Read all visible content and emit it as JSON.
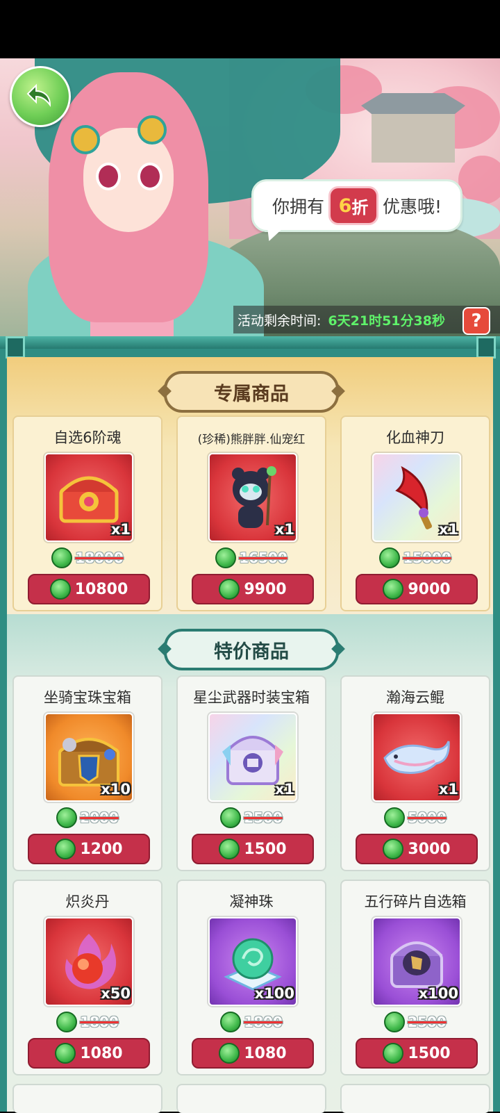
{
  "banner": {
    "bubble_prefix": "你拥有",
    "discount_number": "6",
    "discount_suffix": "折",
    "bubble_suffix": "优惠哦!",
    "timer_label": "活动剩余时间:",
    "timer_value": "6天21时51分38秒",
    "help_label": "?"
  },
  "sections": [
    {
      "title": "专属商品",
      "items": [
        {
          "name": "自选6阶魂",
          "qty": "x1",
          "original_price": "18000",
          "price": "10800",
          "icon": "treasure-chest-icon"
        },
        {
          "name": "(珍稀)熊胖胖.仙宠红",
          "qty": "x1",
          "original_price": "16500",
          "price": "9900",
          "icon": "panda-pet-icon"
        },
        {
          "name": "化血神刀",
          "qty": "x1",
          "original_price": "15000",
          "price": "9000",
          "icon": "blade-icon"
        }
      ]
    },
    {
      "title": "特价商品",
      "items": [
        {
          "name": "坐骑宝珠宝箱",
          "qty": "x10",
          "original_price": "2000",
          "price": "1200",
          "icon": "mount-chest-icon"
        },
        {
          "name": "星尘武器时装宝箱",
          "qty": "x1",
          "original_price": "2500",
          "price": "1500",
          "icon": "weapon-chest-icon"
        },
        {
          "name": "瀚海云鲲",
          "qty": "x1",
          "original_price": "5000",
          "price": "3000",
          "icon": "whale-icon"
        },
        {
          "name": "炽炎丹",
          "qty": "x50",
          "original_price": "1800",
          "price": "1080",
          "icon": "flame-pill-icon"
        },
        {
          "name": "凝神珠",
          "qty": "x100",
          "original_price": "1800",
          "price": "1080",
          "icon": "jade-orb-icon"
        },
        {
          "name": "五行碎片自选箱",
          "qty": "x100",
          "original_price": "2500",
          "price": "1500",
          "icon": "shard-box-icon"
        }
      ]
    }
  ]
}
